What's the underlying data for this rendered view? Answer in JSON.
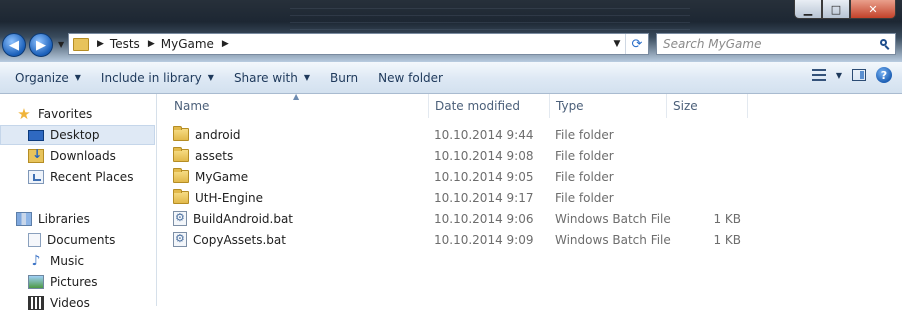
{
  "window": {
    "minimize_glyph": "▁",
    "maximize_glyph": "□",
    "close_glyph": "✕"
  },
  "address_bar": {
    "crumbs": [
      "Tests",
      "MyGame"
    ],
    "separator": "▶",
    "back_glyph": "◀",
    "forward_glyph": "▶",
    "dropdown_glyph": "▼",
    "refresh_glyph": "⟳"
  },
  "search": {
    "placeholder": "Search MyGame"
  },
  "toolbar": {
    "organize": "Organize",
    "include_in_library": "Include in library",
    "share_with": "Share with",
    "burn": "Burn",
    "new_folder": "New folder",
    "dropdown_glyph": "▼",
    "help_glyph": "?"
  },
  "sidebar": {
    "favorites": {
      "label": "Favorites",
      "items": [
        {
          "label": "Desktop",
          "icon": "desktop-icon"
        },
        {
          "label": "Downloads",
          "icon": "downloads-icon"
        },
        {
          "label": "Recent Places",
          "icon": "recent-places-icon"
        }
      ]
    },
    "libraries": {
      "label": "Libraries",
      "items": [
        {
          "label": "Documents",
          "icon": "documents-icon"
        },
        {
          "label": "Music",
          "icon": "music-icon"
        },
        {
          "label": "Pictures",
          "icon": "pictures-icon"
        },
        {
          "label": "Videos",
          "icon": "videos-icon"
        }
      ]
    }
  },
  "columns": {
    "name": "Name",
    "date_modified": "Date modified",
    "type": "Type",
    "size": "Size",
    "sort_glyph": "▲"
  },
  "files": [
    {
      "name": "android",
      "date": "10.10.2014 9:44",
      "type": "File folder",
      "size": "",
      "icon": "folder-icon"
    },
    {
      "name": "assets",
      "date": "10.10.2014 9:08",
      "type": "File folder",
      "size": "",
      "icon": "folder-icon"
    },
    {
      "name": "MyGame",
      "date": "10.10.2014 9:05",
      "type": "File folder",
      "size": "",
      "icon": "folder-icon"
    },
    {
      "name": "UtH-Engine",
      "date": "10.10.2014 9:17",
      "type": "File folder",
      "size": "",
      "icon": "folder-icon"
    },
    {
      "name": "BuildAndroid.bat",
      "date": "10.10.2014 9:06",
      "type": "Windows Batch File",
      "size": "1 KB",
      "icon": "batch-file-icon"
    },
    {
      "name": "CopyAssets.bat",
      "date": "10.10.2014 9:09",
      "type": "Windows Batch File",
      "size": "1 KB",
      "icon": "batch-file-icon"
    }
  ],
  "colors": {
    "selection": "#dfe9f5",
    "command_text": "#1e395b",
    "muted_text": "#6d6d6d",
    "folder": "#e2b94b"
  }
}
